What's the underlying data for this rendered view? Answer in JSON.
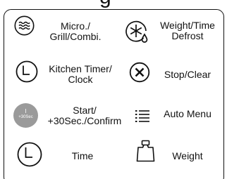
{
  "heading": "g",
  "buttons": {
    "micro_grill": {
      "line1": "Micro./",
      "line2": "Grill/Combi.",
      "icon": "microwave-waves-icon"
    },
    "weight_defrost": {
      "line1": "Weight/Time",
      "line2": "Defrost",
      "icon": "snowflake-drop-icon"
    },
    "kitchen_timer": {
      "line1": "Kitchen Timer/",
      "line2": "Clock",
      "icon": "clock-icon"
    },
    "stop_clear": {
      "line1": "Stop/Clear",
      "icon": "x-circle-icon"
    },
    "start": {
      "line1": "Start/",
      "line2": "+30Sec./Confirm",
      "icon_top": "I",
      "icon_bottom": "+30Sec"
    },
    "auto_menu": {
      "line1": "Auto Menu",
      "icon": "list-icon"
    },
    "time": {
      "line1": "Time",
      "icon": "clock-icon"
    },
    "weight": {
      "line1": "Weight",
      "icon": "weight-icon"
    }
  },
  "colors": {
    "ink": "#111111",
    "start_fill": "#9a9a9a",
    "background": "#ffffff"
  }
}
